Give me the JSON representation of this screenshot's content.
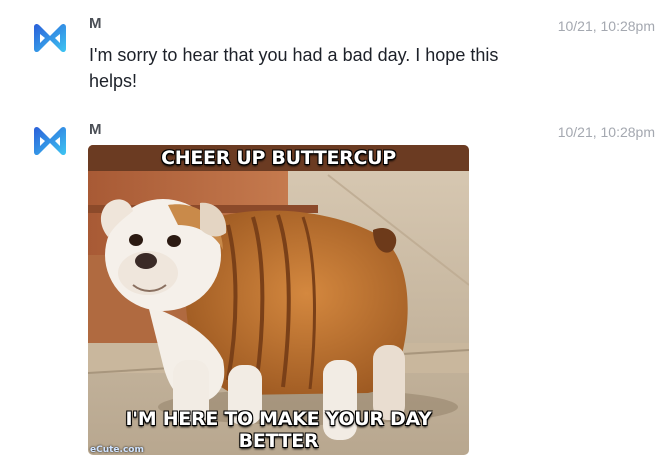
{
  "messages": [
    {
      "sender": "M",
      "timestamp": "10/21, 10:28pm",
      "text": "I'm sorry to hear that you had a bad day. I hope this helps!",
      "avatar_icon": "m-assistant-logo-icon"
    },
    {
      "sender": "M",
      "timestamp": "10/21, 10:28pm",
      "avatar_icon": "m-assistant-logo-icon",
      "image": {
        "top_caption": "CHEER UP BUTTERCUP",
        "bottom_caption": "I'M HERE TO MAKE YOUR DAY BETTER",
        "watermark": "eCute.com"
      }
    }
  ],
  "colors": {
    "logo_gradient_start": "#2f6fe0",
    "logo_gradient_end": "#42c3f5",
    "sender": "#4b4f56",
    "timestamp": "#a4a8b0"
  }
}
